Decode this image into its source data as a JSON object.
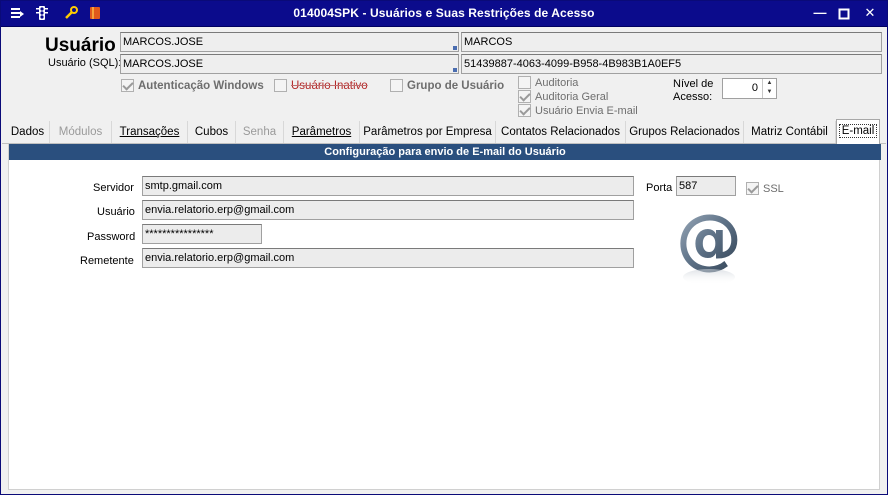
{
  "window": {
    "title": "014004SPK - Usuários e Suas Restrições de Acesso"
  },
  "colors": {
    "titlebar": "#0b0b8c",
    "panel_header": "#2a4f7e",
    "inactive_red": "#b42828"
  },
  "header": {
    "usuario_label": "Usuário",
    "usuario_login": "MARCOS.JOSE",
    "usuario_name": "MARCOS",
    "usuario_sql_label": "Usuário (SQL):",
    "usuario_sql": "MARCOS.JOSE",
    "usuario_guid": "51439887-4063-4099-B958-4B983B1A0EF5",
    "checkboxes": {
      "autenticacao_windows": {
        "label": "Autenticação Windows",
        "checked": true
      },
      "usuario_inativo": {
        "label": "Usuário Inativo",
        "checked": false
      },
      "grupo_de_usuario": {
        "label": "Grupo de Usuário",
        "checked": false
      },
      "auditoria": {
        "label": "Auditoria",
        "checked": false
      },
      "auditoria_geral": {
        "label": "Auditoria Geral",
        "checked": true
      },
      "usuario_envia_email": {
        "label": "Usuário Envia E-mail",
        "checked": true
      }
    },
    "nivel_acesso_label_1": "Nível de",
    "nivel_acesso_label_2": "Acesso:",
    "nivel_acesso_value": "0"
  },
  "tabs": [
    {
      "label": "Dados",
      "state": "normal"
    },
    {
      "label": "Módulos",
      "state": "disabled"
    },
    {
      "label": "Transações",
      "state": "normal"
    },
    {
      "label": "Cubos",
      "state": "normal"
    },
    {
      "label": "Senha",
      "state": "disabled"
    },
    {
      "label": "Parâmetros",
      "state": "normal"
    },
    {
      "label": "Parâmetros por Empresa",
      "state": "normal"
    },
    {
      "label": "Contatos Relacionados",
      "state": "normal"
    },
    {
      "label": "Grupos Relacionados",
      "state": "normal"
    },
    {
      "label": "Matriz Contábil",
      "state": "normal"
    },
    {
      "label": "E-mail",
      "state": "active"
    }
  ],
  "email_panel": {
    "title": "Configuração para envio de E-mail do Usuário",
    "servidor_label": "Servidor",
    "servidor_value": "smtp.gmail.com",
    "usuario_label": "Usuário",
    "usuario_value": "envia.relatorio.erp@gmail.com",
    "password_label": "Password",
    "password_value": "****************",
    "remetente_label": "Remetente",
    "remetente_value": "envia.relatorio.erp@gmail.com",
    "porta_label": "Porta",
    "porta_value": "587",
    "ssl_label": "SSL",
    "ssl_checked": true,
    "logo_icon": "at-sign-icon"
  }
}
